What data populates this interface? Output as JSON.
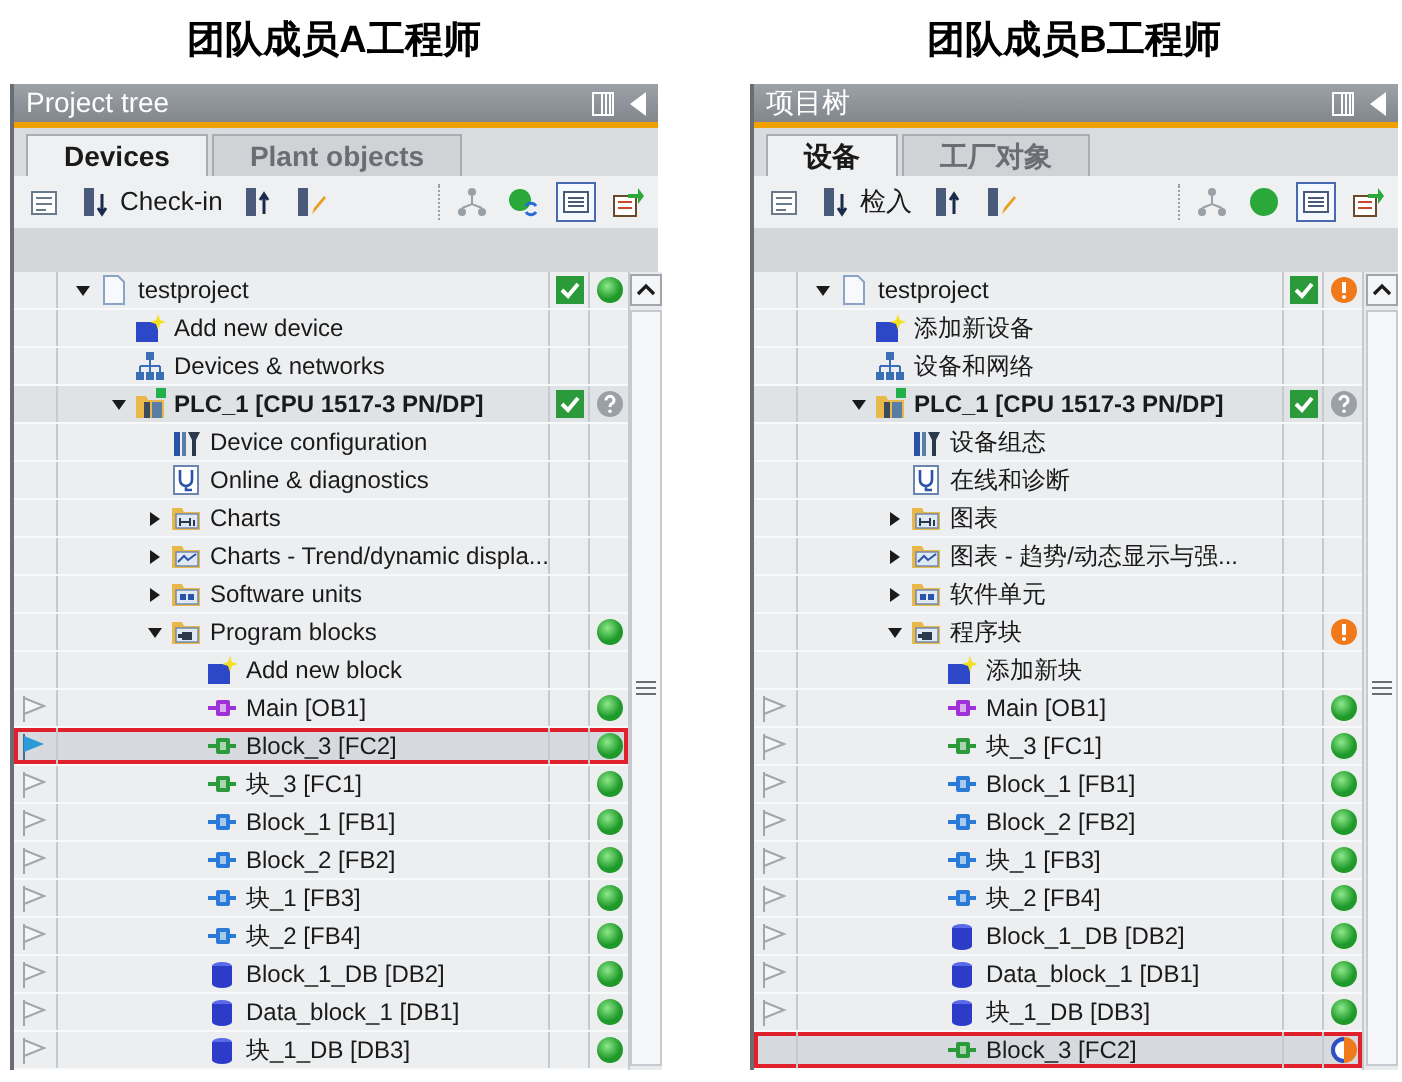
{
  "panels": [
    {
      "heading": "团队成员A工程师",
      "title": "Project tree",
      "tabs": [
        {
          "label": "Devices",
          "selected": true
        },
        {
          "label": "Plant objects",
          "selected": false
        }
      ],
      "toolbar": [
        {
          "kind": "properties",
          "pressed": false
        },
        {
          "kind": "check-in",
          "label": "Check-in",
          "pressed": false
        },
        {
          "kind": "check-out",
          "pressed": false
        },
        {
          "kind": "edit",
          "pressed": false
        },
        {
          "kind": "separator"
        },
        {
          "kind": "network",
          "pressed": false
        },
        {
          "kind": "refresh",
          "pressed": false
        },
        {
          "kind": "list-view",
          "pressed": true
        },
        {
          "kind": "export",
          "pressed": false
        }
      ],
      "tree": [
        {
          "label": "testproject",
          "kind": "project",
          "expanded": true,
          "checkmark": true,
          "status": {
            "kind": "ok"
          },
          "children": [
            {
              "label": "Add new device",
              "kind": "add-device"
            },
            {
              "label": "Devices & networks",
              "kind": "network"
            },
            {
              "label": "PLC_1 [CPU 1517-3 PN/DP]",
              "kind": "plc",
              "expanded": true,
              "emphasis": true,
              "checkmark": true,
              "status": {
                "kind": "unknown"
              },
              "children": [
                {
                  "label": "Device configuration",
                  "kind": "device-config"
                },
                {
                  "label": "Online & diagnostics",
                  "kind": "diagnostics"
                },
                {
                  "label": "Charts",
                  "kind": "folder-chart",
                  "expanded": false
                },
                {
                  "label": "Charts - Trend/dynamic displa...",
                  "kind": "folder-trend",
                  "expanded": false
                },
                {
                  "label": "Software units",
                  "kind": "folder-units",
                  "expanded": false
                },
                {
                  "label": "Program blocks",
                  "kind": "folder-blocks",
                  "expanded": true,
                  "status": {
                    "kind": "ok"
                  },
                  "children": [
                    {
                      "label": "Add new block",
                      "kind": "add-block"
                    },
                    {
                      "label": "Main [OB1]",
                      "kind": "ob",
                      "flag": {
                        "kind": "plain"
                      },
                      "status": {
                        "kind": "ok"
                      }
                    },
                    {
                      "label": "Block_3 [FC2]",
                      "kind": "fc",
                      "flag": {
                        "kind": "marked"
                      },
                      "status": {
                        "kind": "ok"
                      },
                      "selected": true,
                      "highlighted": true
                    },
                    {
                      "label": "块_3 [FC1]",
                      "kind": "fc",
                      "flag": {
                        "kind": "plain"
                      },
                      "status": {
                        "kind": "ok"
                      }
                    },
                    {
                      "label": "Block_1 [FB1]",
                      "kind": "fb",
                      "flag": {
                        "kind": "plain"
                      },
                      "status": {
                        "kind": "ok"
                      }
                    },
                    {
                      "label": "Block_2 [FB2]",
                      "kind": "fb",
                      "flag": {
                        "kind": "plain"
                      },
                      "status": {
                        "kind": "ok"
                      }
                    },
                    {
                      "label": "块_1 [FB3]",
                      "kind": "fb",
                      "flag": {
                        "kind": "plain"
                      },
                      "status": {
                        "kind": "ok"
                      }
                    },
                    {
                      "label": "块_2 [FB4]",
                      "kind": "fb",
                      "flag": {
                        "kind": "plain"
                      },
                      "status": {
                        "kind": "ok"
                      }
                    },
                    {
                      "label": "Block_1_DB [DB2]",
                      "kind": "db",
                      "flag": {
                        "kind": "plain"
                      },
                      "status": {
                        "kind": "ok"
                      }
                    },
                    {
                      "label": "Data_block_1 [DB1]",
                      "kind": "db",
                      "flag": {
                        "kind": "plain"
                      },
                      "status": {
                        "kind": "ok"
                      }
                    },
                    {
                      "label": "块_1_DB [DB3]",
                      "kind": "db",
                      "flag": {
                        "kind": "plain"
                      },
                      "status": {
                        "kind": "ok"
                      }
                    }
                  ]
                }
              ]
            }
          ]
        }
      ]
    },
    {
      "heading": "团队成员B工程师",
      "title": "项目树",
      "tabs": [
        {
          "label": "设备",
          "selected": true
        },
        {
          "label": "工厂对象",
          "selected": false
        }
      ],
      "toolbar": [
        {
          "kind": "properties",
          "pressed": false
        },
        {
          "kind": "check-in",
          "label": "检入",
          "pressed": false
        },
        {
          "kind": "check-out",
          "pressed": false
        },
        {
          "kind": "edit",
          "pressed": false
        },
        {
          "kind": "separator"
        },
        {
          "kind": "network",
          "pressed": false
        },
        {
          "kind": "online",
          "pressed": false
        },
        {
          "kind": "list-view",
          "pressed": true
        },
        {
          "kind": "export",
          "pressed": false
        }
      ],
      "tree": [
        {
          "label": "testproject",
          "kind": "project",
          "expanded": true,
          "checkmark": true,
          "status": {
            "kind": "warning"
          },
          "children": [
            {
              "label": "添加新设备",
              "kind": "add-device"
            },
            {
              "label": "设备和网络",
              "kind": "network"
            },
            {
              "label": "PLC_1 [CPU 1517-3 PN/DP]",
              "kind": "plc",
              "expanded": true,
              "emphasis": true,
              "checkmark": true,
              "status": {
                "kind": "unknown"
              },
              "children": [
                {
                  "label": "设备组态",
                  "kind": "device-config"
                },
                {
                  "label": "在线和诊断",
                  "kind": "diagnostics"
                },
                {
                  "label": "图表",
                  "kind": "folder-chart",
                  "expanded": false
                },
                {
                  "label": "图表 - 趋势/动态显示与强...",
                  "kind": "folder-trend",
                  "expanded": false
                },
                {
                  "label": "软件单元",
                  "kind": "folder-units",
                  "expanded": false
                },
                {
                  "label": "程序块",
                  "kind": "folder-blocks",
                  "expanded": true,
                  "status": {
                    "kind": "warning"
                  },
                  "children": [
                    {
                      "label": "添加新块",
                      "kind": "add-block"
                    },
                    {
                      "label": "Main [OB1]",
                      "kind": "ob",
                      "flag": {
                        "kind": "plain"
                      },
                      "status": {
                        "kind": "ok"
                      }
                    },
                    {
                      "label": "块_3 [FC1]",
                      "kind": "fc",
                      "flag": {
                        "kind": "plain"
                      },
                      "status": {
                        "kind": "ok"
                      }
                    },
                    {
                      "label": "Block_1 [FB1]",
                      "kind": "fb",
                      "flag": {
                        "kind": "plain"
                      },
                      "status": {
                        "kind": "ok"
                      }
                    },
                    {
                      "label": "Block_2 [FB2]",
                      "kind": "fb",
                      "flag": {
                        "kind": "plain"
                      },
                      "status": {
                        "kind": "ok"
                      }
                    },
                    {
                      "label": "块_1 [FB3]",
                      "kind": "fb",
                      "flag": {
                        "kind": "plain"
                      },
                      "status": {
                        "kind": "ok"
                      }
                    },
                    {
                      "label": "块_2 [FB4]",
                      "kind": "fb",
                      "flag": {
                        "kind": "plain"
                      },
                      "status": {
                        "kind": "ok"
                      }
                    },
                    {
                      "label": "Block_1_DB [DB2]",
                      "kind": "db",
                      "flag": {
                        "kind": "plain"
                      },
                      "status": {
                        "kind": "ok"
                      }
                    },
                    {
                      "label": "Data_block_1 [DB1]",
                      "kind": "db",
                      "flag": {
                        "kind": "plain"
                      },
                      "status": {
                        "kind": "ok"
                      }
                    },
                    {
                      "label": "块_1_DB [DB3]",
                      "kind": "db",
                      "flag": {
                        "kind": "plain"
                      },
                      "status": {
                        "kind": "ok"
                      }
                    },
                    {
                      "label": "Block_3 [FC2]",
                      "kind": "fc",
                      "status": {
                        "kind": "compare"
                      },
                      "selected": true,
                      "highlighted": true
                    }
                  ]
                }
              ]
            }
          ]
        }
      ]
    }
  ]
}
